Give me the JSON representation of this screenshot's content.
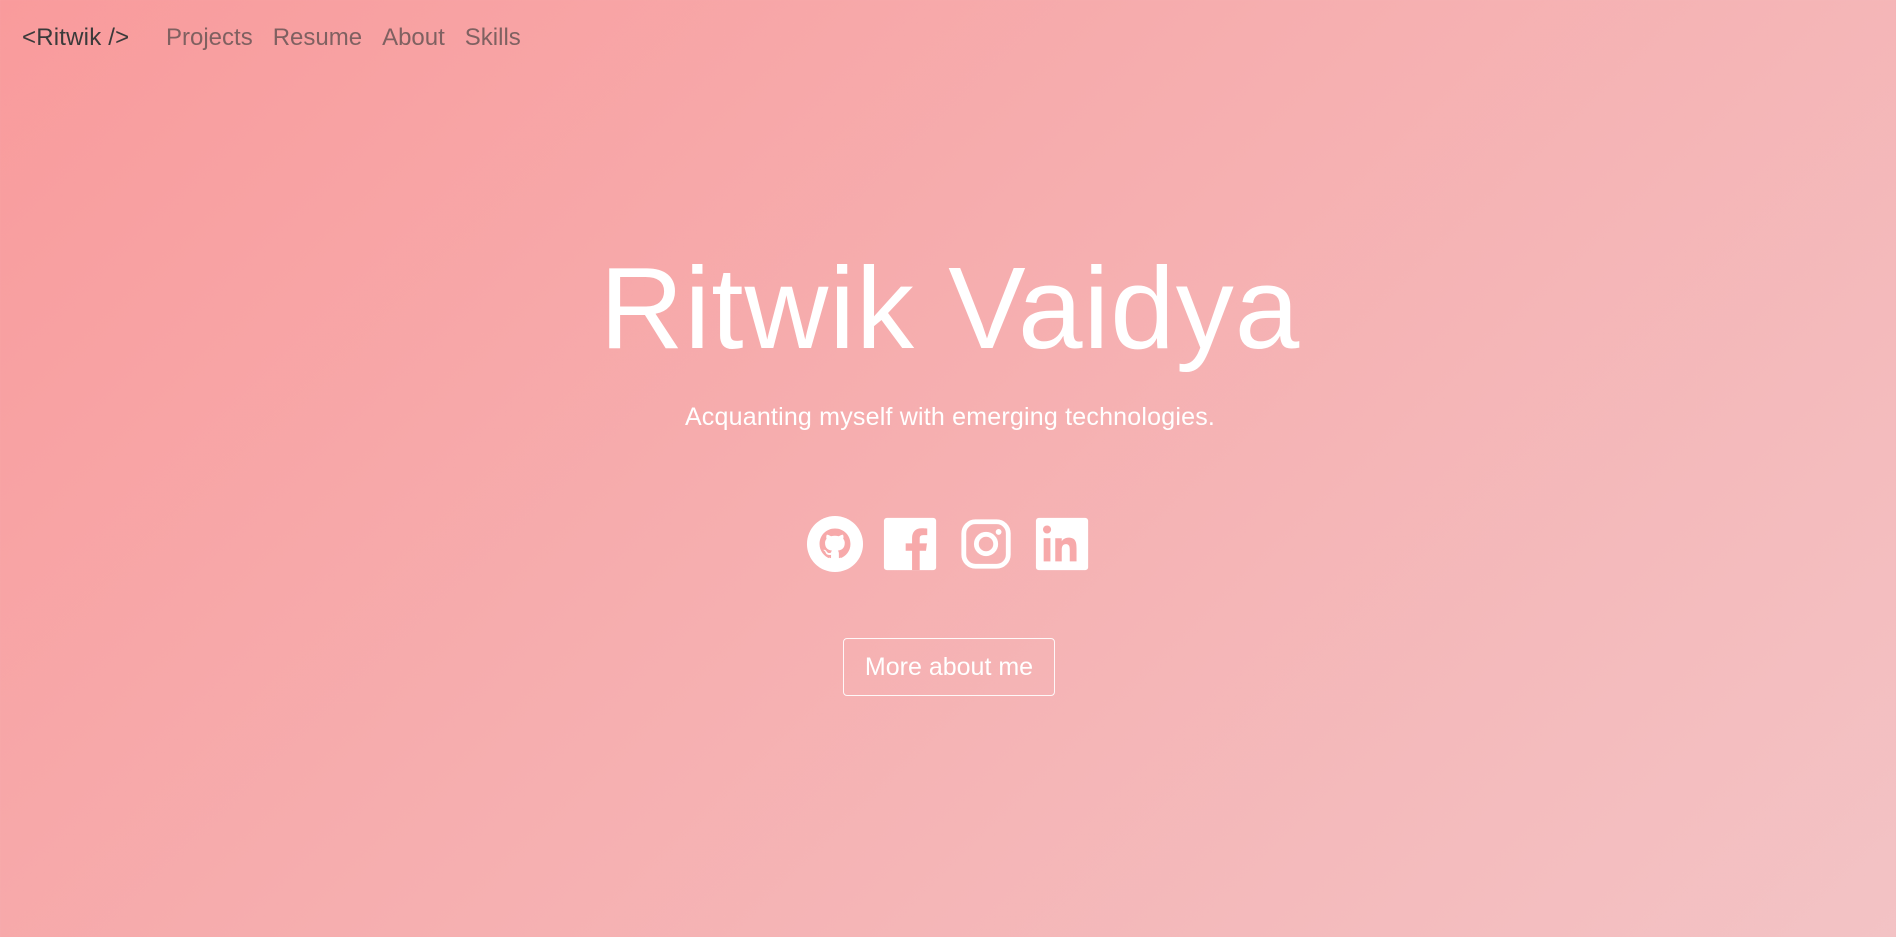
{
  "nav": {
    "brand": "<Ritwik />",
    "links": [
      "Projects",
      "Resume",
      "About",
      "Skills"
    ]
  },
  "hero": {
    "title": "Ritwik Vaidya",
    "subtitle": "Acquanting myself with emerging technologies.",
    "button_label": "More about me"
  },
  "social": {
    "icons": [
      "github-icon",
      "facebook-icon",
      "instagram-icon",
      "linkedin-icon"
    ]
  },
  "colors": {
    "background_start": "#f99b9c",
    "background_end": "#f3c3c5",
    "text_light": "#ffffff",
    "brand_text": "#3a3a3a",
    "nav_text": "#6b5656"
  }
}
